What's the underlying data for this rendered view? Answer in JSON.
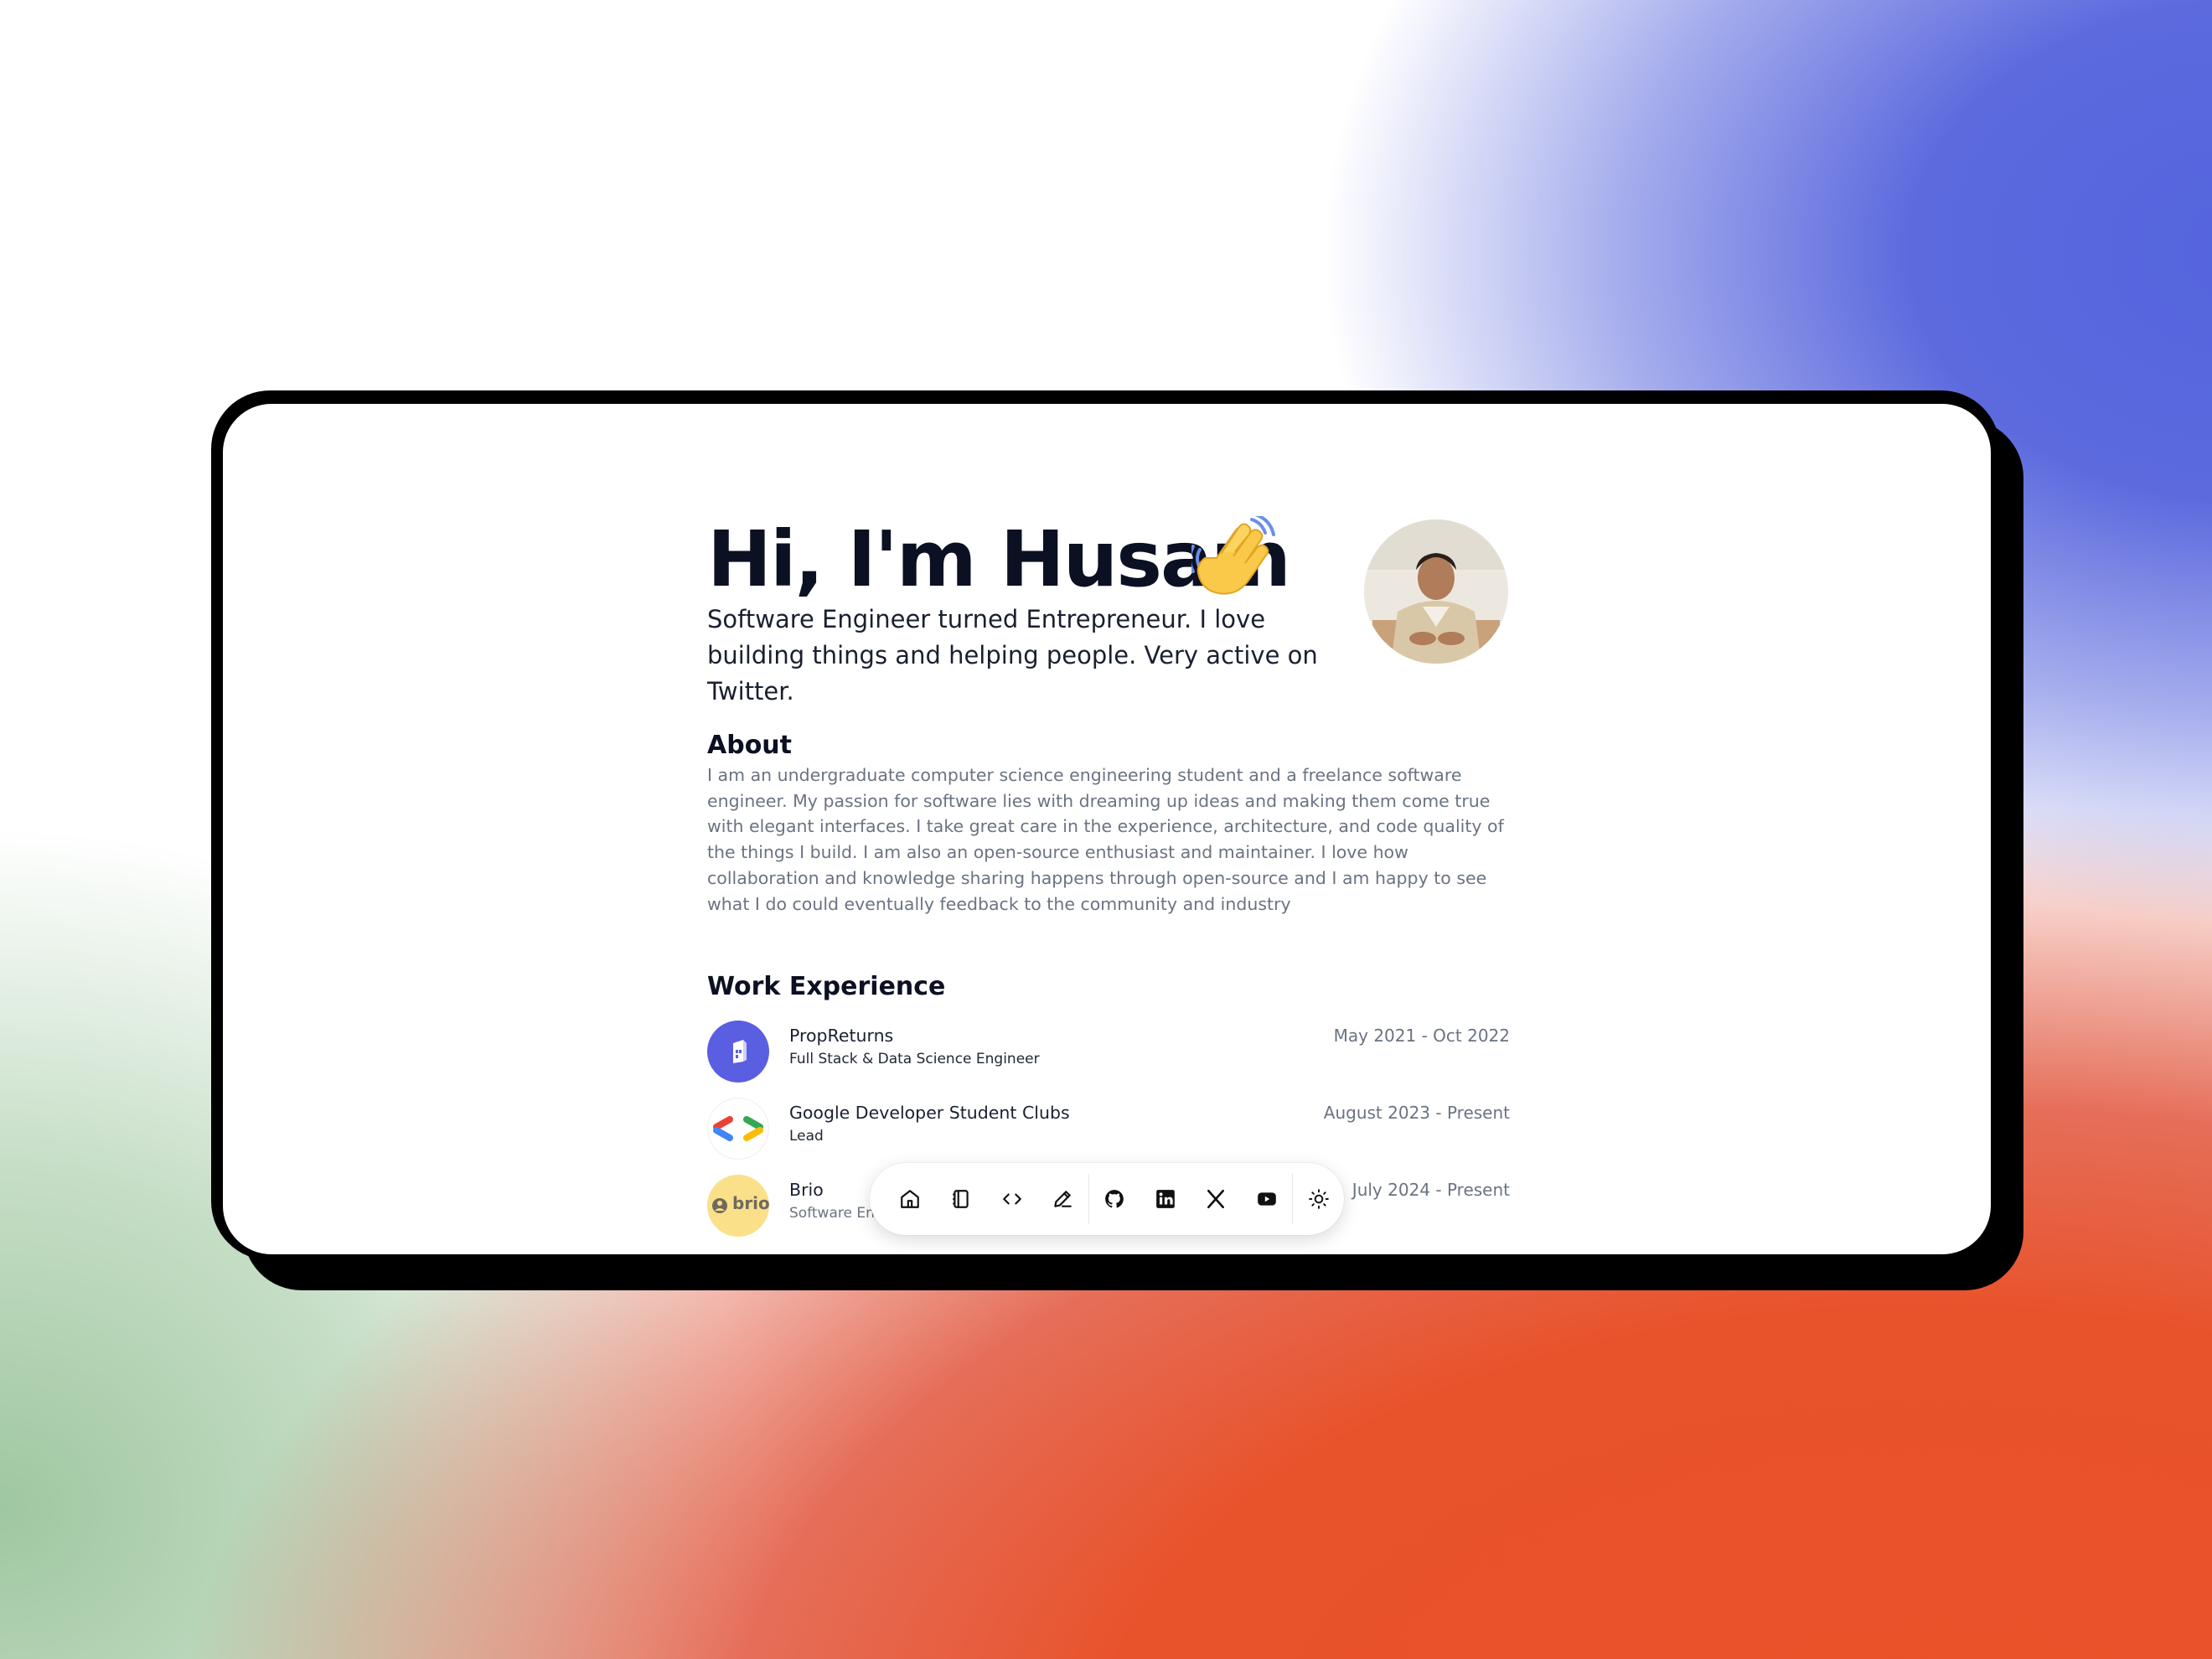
{
  "hero": {
    "title": "Hi, I'm Husam",
    "wave_icon": "waving-hand-emoji",
    "subtitle": "Software Engineer turned Entrepreneur. I love building things and helping people. Very active on Twitter."
  },
  "about": {
    "title": "About",
    "body": "I am an undergraduate computer science engineering student and a freelance software engineer. My passion for software lies with dreaming up ideas and making them come true with elegant interfaces. I take great care in the experience, architecture, and code quality of the things I build. I am also an open-source enthusiast and maintainer. I love how collaboration and knowledge sharing happens through open-source and I am happy to see what I do could eventually feedback to the community and industry"
  },
  "work": {
    "title": "Work Experience",
    "items": [
      {
        "company": "PropReturns",
        "role": "Full Stack & Data Science Engineer",
        "dates": "May 2021 - Oct 2022",
        "logo": "propreturns-logo"
      },
      {
        "company": "Google Developer Student Clubs",
        "role": "Lead",
        "dates": "August 2023 - Present",
        "logo": "gdsc-logo"
      },
      {
        "company": "Brio",
        "role": "Software Eng",
        "dates": "July 2024 - Present",
        "logo": "brio-logo",
        "logo_text": "brio"
      }
    ]
  },
  "dock": {
    "icons": [
      "home-icon",
      "notebook-icon",
      "code-icon",
      "pencil-icon",
      "github-icon",
      "linkedin-icon",
      "x-icon",
      "youtube-icon",
      "sun-icon"
    ]
  },
  "colors": {
    "background_blue": "#5c6ade",
    "background_orange": "#ea5129",
    "text_dark": "#0b1022",
    "text_muted": "#6b7382",
    "propreturns_blue": "#5a5ee0",
    "brio_yellow": "#fbe08a"
  }
}
